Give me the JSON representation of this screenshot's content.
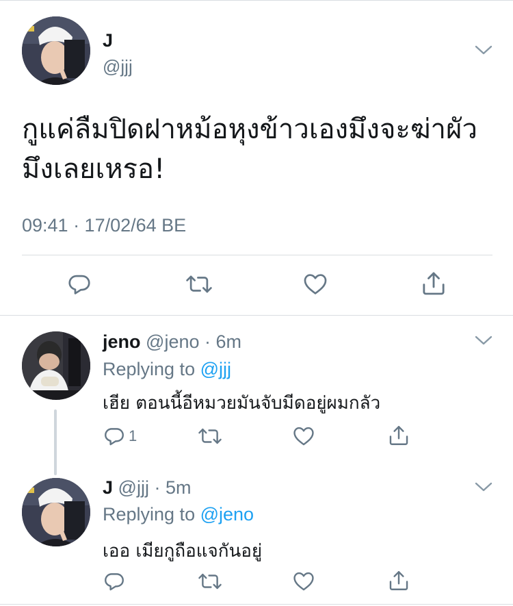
{
  "main": {
    "name": "J",
    "handle": "@jjj",
    "text": "กูแค่ลืมปิดฝาหม้อหุงข้าวเองมึงจะฆ่าผัวมึงเลยเหรอ!",
    "meta": "09:41 · 17/02/64 BE",
    "actions": [
      "reply-icon",
      "retweet-icon",
      "like-icon",
      "share-icon"
    ]
  },
  "replies": [
    {
      "name": "jeno",
      "handle": "@jeno",
      "time": "· 6m",
      "replying_prefix": "Replying to ",
      "replying_to": "@jjj",
      "text": "เฮีย ตอนนี้อีหมวยมันจับมีดอยู่ผมกลัว",
      "reply_count": "1"
    },
    {
      "name": "J",
      "handle": "@jjj",
      "time": "· 5m",
      "replying_prefix": "Replying to ",
      "replying_to": "@jeno",
      "text": "เออ เมียกูถือแจกันอยู่",
      "reply_count": ""
    }
  ],
  "colors": {
    "text": "#14171a",
    "secondary": "#657786",
    "accent": "#1da1f2",
    "divider": "#d9dde1"
  }
}
